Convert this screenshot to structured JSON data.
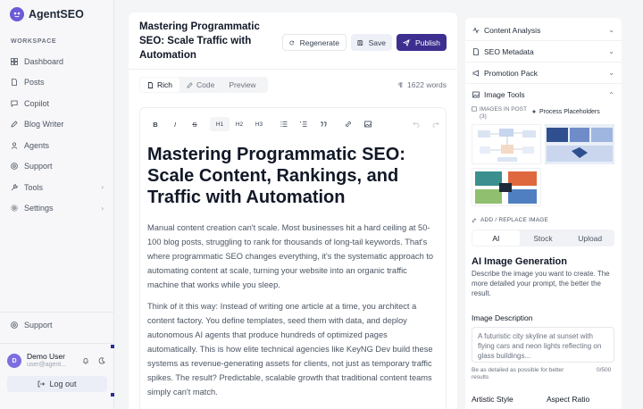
{
  "app": {
    "name": "AgentSEO"
  },
  "sidebar": {
    "section_label": "WORKSPACE",
    "items": [
      {
        "label": "Dashboard",
        "icon": "grid-icon"
      },
      {
        "label": "Posts",
        "icon": "document-icon"
      },
      {
        "label": "Copilot",
        "icon": "chat-icon"
      },
      {
        "label": "Blog Writer",
        "icon": "pen-icon"
      },
      {
        "label": "Agents",
        "icon": "agent-icon"
      },
      {
        "label": "Support",
        "icon": "help-icon"
      },
      {
        "label": "Tools",
        "icon": "wrench-icon",
        "chevron": "›"
      },
      {
        "label": "Settings",
        "icon": "gear-icon",
        "chevron": "›"
      }
    ],
    "support_bottom": "Support",
    "user": {
      "initial": "D",
      "name": "Demo User",
      "email": "user@agent..."
    },
    "logout": "Log out"
  },
  "editor": {
    "title": "Mastering Programmatic SEO: Scale Traffic with Automation",
    "buttons": {
      "regenerate": "Regenerate",
      "save": "Save",
      "publish": "Publish"
    },
    "tabs": [
      "Rich",
      "Code",
      "Preview"
    ],
    "word_count": "1622 words",
    "toolbar": [
      "B",
      "I",
      "S",
      "H1",
      "H2",
      "H3"
    ],
    "heading": "Mastering Programmatic SEO: Scale Content, Rankings, and Traffic with Automation",
    "paragraph1": "Manual content creation can't scale. Most businesses hit a hard ceiling at 50-100 blog posts, struggling to rank for thousands of long-tail keywords. That's where programmatic SEO changes everything, it's the systematic approach to automating content at scale, turning your website into an organic traffic machine that works while you sleep.",
    "paragraph2": "Think of it this way: Instead of writing one article at a time, you architect a content factory. You define templates, seed them with data, and deploy autonomous AI agents that produce hundreds of optimized pages automatically. This is how elite technical agencies like KeyNG Dev build these systems as revenue-generating assets for clients, not just as temporary traffic spikes. The result? Predictable, scalable growth that traditional content teams simply can't match."
  },
  "panel": {
    "sections": [
      {
        "label": "Content Analysis",
        "icon": "pulse-icon",
        "chevron": "⌄"
      },
      {
        "label": "SEO Metadata",
        "icon": "document-icon",
        "chevron": "⌄"
      },
      {
        "label": "Promotion Pack",
        "icon": "megaphone-icon",
        "chevron": "⌄"
      },
      {
        "label": "Image Tools",
        "icon": "image-icon",
        "chevron": "⌃"
      }
    ],
    "images_in_post": "IMAGES IN POST (3)",
    "process_placeholders": "Process Placeholders",
    "add_replace": "ADD / REPLACE IMAGE",
    "segments": [
      "AI",
      "Stock",
      "Upload"
    ],
    "ai_title": "AI Image Generation",
    "ai_desc": "Describe the image you want to create. The more detailed your prompt, the better the result.",
    "image_desc_label": "Image Description",
    "image_desc_placeholder": "A futuristic city skyline at sunset with flying cars and neon lights reflecting on glass buildings...",
    "hint": "Be as detailed as possible for better results",
    "counter": "0/500",
    "artistic_style": "Artistic Style",
    "aspect_ratio": "Aspect Ratio"
  },
  "colors": {
    "accent": "#3d2f8f",
    "brand": "#6b5bd6"
  }
}
